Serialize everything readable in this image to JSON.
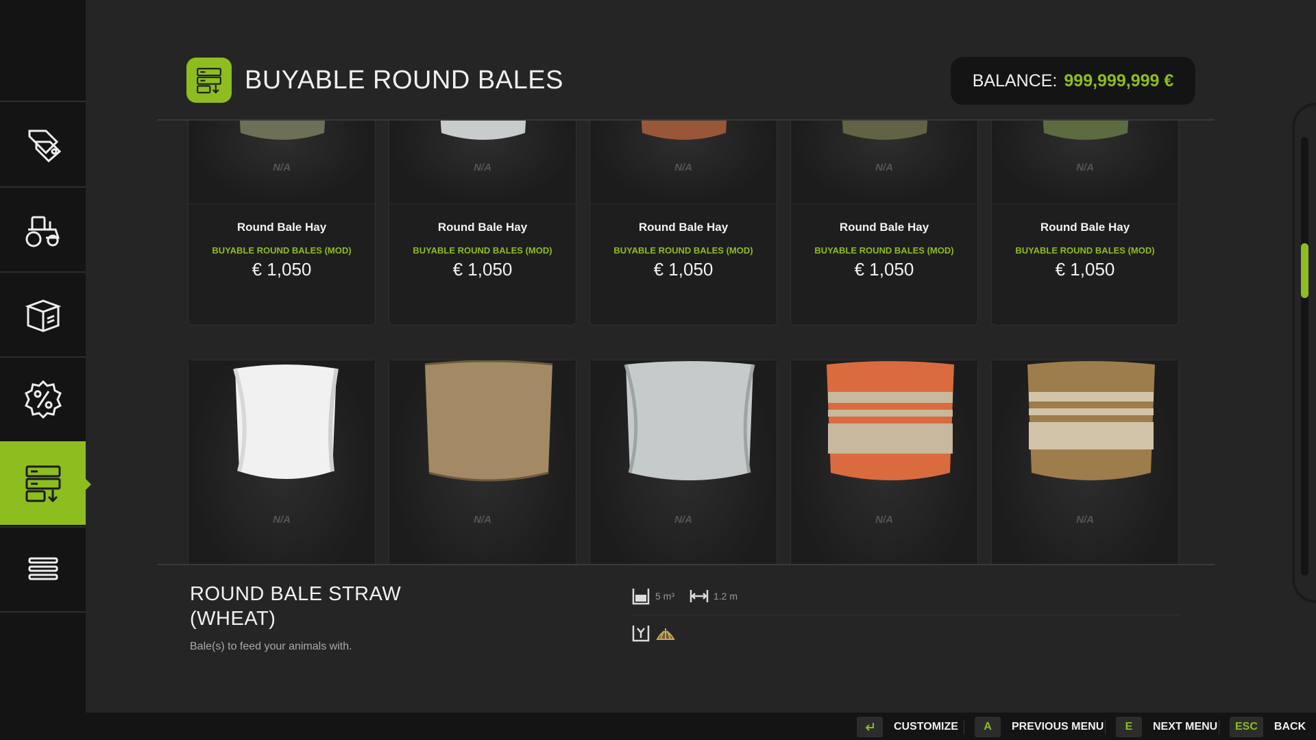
{
  "header": {
    "title": "BUYABLE ROUND BALES",
    "balance_label": "BALANCE:",
    "balance_value": "999,999,999 €",
    "icon": "bale-shop-icon"
  },
  "sidebar": {
    "items": [
      {
        "icon": "price-tags-icon",
        "active": false
      },
      {
        "icon": "tractor-icon",
        "active": false
      },
      {
        "icon": "box-icon",
        "active": false
      },
      {
        "icon": "percent-badge-icon",
        "active": false
      },
      {
        "icon": "bale-shop-icon",
        "active": true
      },
      {
        "icon": "menu-list-icon",
        "active": false
      }
    ]
  },
  "items_top": [
    {
      "na": "N/A",
      "name": "Round Bale Hay",
      "mod": "BUYABLE ROUND BALES (MOD)",
      "price": "€ 1,050",
      "color": "#6d7056"
    },
    {
      "na": "N/A",
      "name": "Round Bale Hay",
      "mod": "BUYABLE ROUND BALES (MOD)",
      "price": "€ 1,050",
      "color": "#c9cccc"
    },
    {
      "na": "N/A",
      "name": "Round Bale Hay",
      "mod": "BUYABLE ROUND BALES (MOD)",
      "price": "€ 1,050",
      "color": "#9a5638"
    },
    {
      "na": "N/A",
      "name": "Round Bale Hay",
      "mod": "BUYABLE ROUND BALES (MOD)",
      "price": "€ 1,050",
      "color": "#626344"
    },
    {
      "na": "N/A",
      "name": "Round Bale Hay",
      "mod": "BUYABLE ROUND BALES (MOD)",
      "price": "€ 1,050",
      "color": "#5d6b40"
    }
  ],
  "items_bottom": [
    {
      "na": "N/A",
      "style": "white-wrap"
    },
    {
      "na": "N/A",
      "style": "burlap"
    },
    {
      "na": "N/A",
      "style": "silver-wrap"
    },
    {
      "na": "N/A",
      "style": "orange-stripe"
    },
    {
      "na": "N/A",
      "style": "brown-stripe"
    }
  ],
  "detail": {
    "title_line1": "ROUND BALE STRAW",
    "title_line2": "(WHEAT)",
    "description": "Bale(s) to feed your animals with.",
    "volume": "5 m³",
    "width": "1.2 m"
  },
  "footer": {
    "customize": "CUSTOMIZE",
    "prev_key": "A",
    "prev_label": "PREVIOUS MENU",
    "next_key": "E",
    "next_label": "NEXT MENU",
    "back_key": "ESC",
    "back_label": "BACK"
  },
  "colors": {
    "accent": "#8dbd1f",
    "background": "#252525",
    "sidebar": "#141414"
  }
}
